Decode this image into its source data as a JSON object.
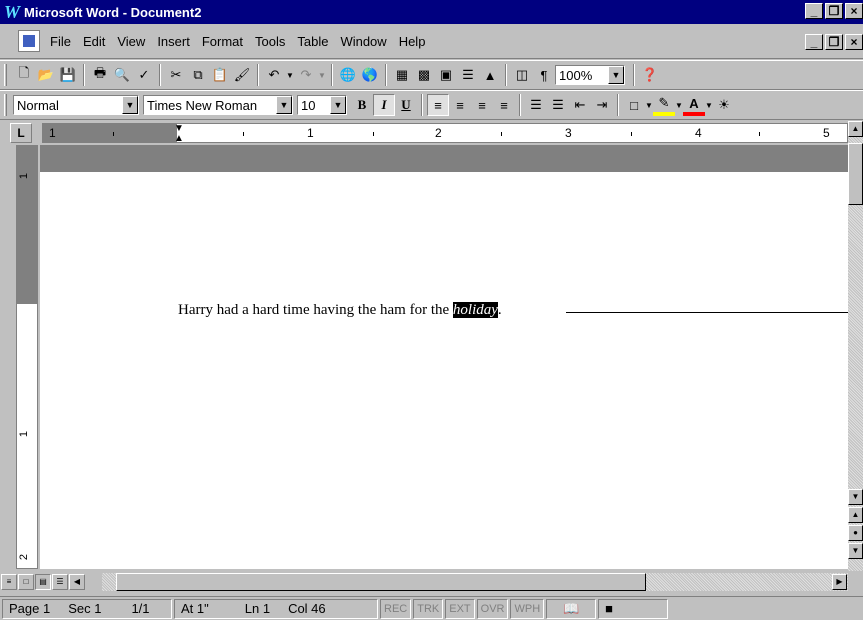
{
  "window": {
    "title": "Microsoft Word - Document2",
    "app_icon_glyph": "W"
  },
  "title_buttons": {
    "minimize": "_",
    "maximize": "̅□",
    "close": "×"
  },
  "menu": {
    "items": [
      {
        "label": "File"
      },
      {
        "label": "Edit"
      },
      {
        "label": "View"
      },
      {
        "label": "Insert"
      },
      {
        "label": "Format"
      },
      {
        "label": "Tools"
      },
      {
        "label": "Table"
      },
      {
        "label": "Window"
      },
      {
        "label": "Help"
      }
    ]
  },
  "standard_toolbar": {
    "zoom": "100%"
  },
  "formatting_toolbar": {
    "style": "Normal",
    "font": "Times New Roman",
    "size": "10",
    "bold": "B",
    "italic": "I",
    "underline": "U"
  },
  "ruler": {
    "tab_selector": "L",
    "numbers": [
      "1",
      "1",
      "2",
      "3",
      "4",
      "5"
    ]
  },
  "vruler": {
    "numbers": [
      "1",
      "1",
      "2"
    ]
  },
  "document": {
    "text_before": "Harry had a hard time having the ham for the ",
    "selected_text": "holiday",
    "text_after": "."
  },
  "status": {
    "page": "Page 1",
    "sec": "Sec 1",
    "pages": "1/1",
    "at": "At 1\"",
    "ln": "Ln 1",
    "col": "Col 46",
    "rec": "REC",
    "trk": "TRK",
    "ext": "EXT",
    "ovr": "OVR",
    "wph": "WPH"
  }
}
